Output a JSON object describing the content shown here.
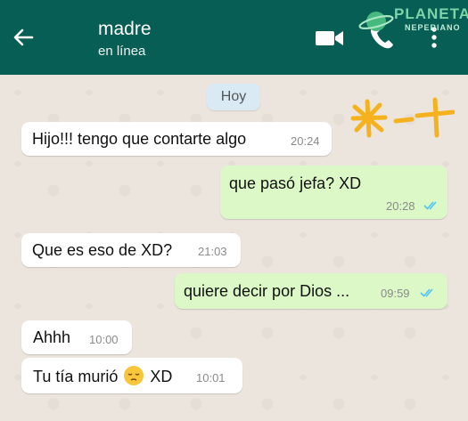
{
  "header": {
    "contact_name": "madre",
    "contact_status": "en línea",
    "accent_color": "#075e54"
  },
  "watermark": {
    "line1": "PLANETA",
    "line2": "NEPERIANO"
  },
  "chat": {
    "day_label": "Hoy",
    "scribble": "*-+",
    "messages": [
      {
        "direction": "incoming",
        "text": "Hijo!!! tengo que contarte algo",
        "time": "20:24"
      },
      {
        "direction": "outgoing",
        "text": "que pasó jefa? XD",
        "time": "20:28",
        "status": "read"
      },
      {
        "direction": "incoming",
        "text": "Que es eso de XD?",
        "time": "21:03"
      },
      {
        "direction": "outgoing",
        "text": "quiere decir por Dios ...",
        "time": "09:59",
        "status": "read"
      },
      {
        "direction": "incoming",
        "text": "Ahhh",
        "time": "10:00"
      },
      {
        "direction": "incoming",
        "text_before": "Tu tía murió",
        "emoji": "pensive-face-emoji",
        "text_after": "XD",
        "time": "10:01"
      }
    ]
  },
  "colors": {
    "incoming_bubble": "#ffffff",
    "outgoing_bubble": "#dcf8c6",
    "read_ticks": "#4fc3f7"
  }
}
